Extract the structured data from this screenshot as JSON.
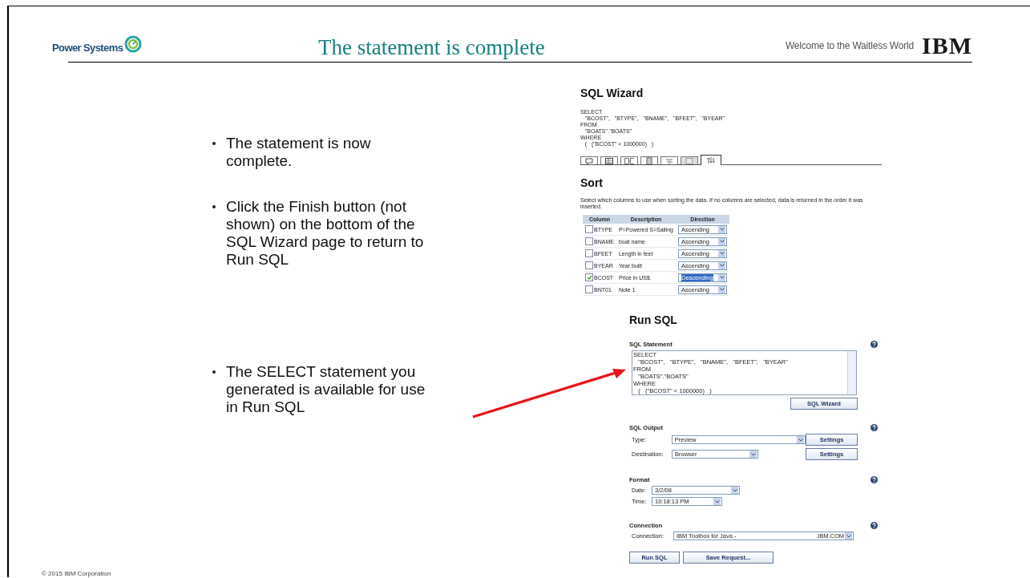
{
  "header": {
    "brand": "Power Systems",
    "title": "The statement is complete",
    "tagline": "Welcome to the Waitless World",
    "logo": "IBM"
  },
  "bullets_top": [
    "The statement is now complete.",
    "Click the Finish button (not shown) on the bottom of the SQL Wizard page to return to Run SQL"
  ],
  "bullets_bottom": [
    "The SELECT statement you generated is available for use in Run SQL"
  ],
  "sql_wizard": {
    "title": "SQL Wizard",
    "statement": [
      "SELECT",
      "   \"BCOST\",   \"BTYPE\",   \"BNAME\",   \"BFEET\",   \"BYEAR\"",
      "FROM",
      "   \"BOATS\".\"BOATS\"",
      "WHERE",
      "   (   (\"BCOST\" < 1000000)   )"
    ],
    "tabs": [
      {
        "kind": "bubble",
        "selected": false,
        "disabled": false
      },
      {
        "kind": "grid",
        "selected": false,
        "disabled": false
      },
      {
        "kind": "grids",
        "selected": false,
        "disabled": false
      },
      {
        "kind": "page",
        "selected": false,
        "disabled": false
      },
      {
        "kind": "marks",
        "selected": false,
        "disabled": false
      },
      {
        "kind": "box",
        "selected": false,
        "disabled": true
      },
      {
        "kind": "sort",
        "selected": true,
        "disabled": false
      }
    ]
  },
  "sort": {
    "title": "Sort",
    "description": "Select which columns to use when sorting the data. If no columns are selected, data is returned in the order it was inserted.",
    "columns": [
      "Column",
      "Description",
      "Direction"
    ],
    "rows": [
      {
        "name": "BTYPE",
        "description": "P=Powered S=Sailing",
        "checked": false,
        "direction": "Ascending",
        "selected": false
      },
      {
        "name": "BNAME",
        "description": "boat name",
        "checked": false,
        "direction": "Ascending",
        "selected": false
      },
      {
        "name": "BFEET",
        "description": "Length in feet",
        "checked": false,
        "direction": "Ascending",
        "selected": false
      },
      {
        "name": "BYEAR",
        "description": "Year built",
        "checked": false,
        "direction": "Ascending",
        "selected": false
      },
      {
        "name": "BCOST",
        "description": "Price in US$",
        "checked": true,
        "direction": "Descending",
        "selected": true
      },
      {
        "name": "BNT01",
        "description": "Note 1",
        "checked": false,
        "direction": "Ascending",
        "selected": false
      }
    ]
  },
  "run_sql": {
    "title": "Run SQL",
    "statement_label": "SQL Statement",
    "statement": [
      "SELECT",
      "   \"BCOST\",   \"BTYPE\",   \"BNAME\",   \"BFEET\",   \"BYEAR\"",
      "FROM",
      "   \"BOATS\".\"BOATS\"",
      "WHERE",
      "   (   (\"BCOST\" < 1000000)   )"
    ],
    "wizard_button": "SQL Wizard",
    "output_label": "SQL Output",
    "type_label": "Type:",
    "type_value": "Preview",
    "type_settings": "Settings",
    "destination_label": "Destination:",
    "destination_value": "Browser",
    "destination_settings": "Settings",
    "format_label": "Format",
    "date_label": "Date:",
    "date_value": "3/2/08",
    "time_label": "Time:",
    "time_value": "10:18:13 PM",
    "connection_section": "Connection",
    "connection_label": "Connection:",
    "connection_value": "IBM Toolbox for Java -",
    "connection_value_end": ".IBM.COM",
    "run_button": "Run SQL",
    "save_button": "Save Request..."
  },
  "footer": "© 2015 IBM Corporation"
}
